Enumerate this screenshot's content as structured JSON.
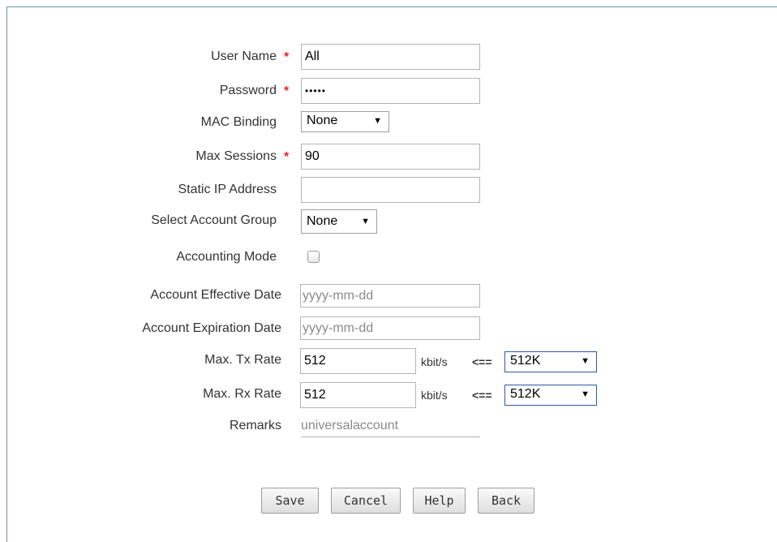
{
  "form": {
    "user_name": {
      "label": "User Name",
      "required": "*",
      "value": "All"
    },
    "password": {
      "label": "Password",
      "required": "*",
      "value": "•••••"
    },
    "mac_binding": {
      "label": "MAC Binding",
      "selected": "None"
    },
    "max_sessions": {
      "label": "Max Sessions",
      "required": "*",
      "value": "90"
    },
    "static_ip": {
      "label": "Static IP Address",
      "value": ""
    },
    "account_group": {
      "label": "Select Account Group",
      "selected": "None"
    },
    "accounting_mode": {
      "label": "Accounting Mode",
      "checked": false
    },
    "effective_date": {
      "label": "Account Effective Date",
      "placeholder": "yyyy-mm-dd"
    },
    "expiration_date": {
      "label": "Account Expiration Date",
      "placeholder": "yyyy-mm-dd"
    },
    "tx_rate": {
      "label": "Max. Tx Rate",
      "value": "512",
      "unit": "kbit/s",
      "arrow": "<==",
      "preset": "512K"
    },
    "rx_rate": {
      "label": "Max. Rx Rate",
      "value": "512",
      "unit": "kbit/s",
      "arrow": "<==",
      "preset": "512K"
    },
    "remarks": {
      "label": "Remarks",
      "value": "universalaccount"
    }
  },
  "icons": {
    "dropdown": "triangle-down-icon"
  },
  "buttons": {
    "save": "Save",
    "cancel": "Cancel",
    "help": "Help",
    "back": "Back"
  },
  "colors": {
    "required": "#e4262a",
    "frame_border": "#5e9c9b",
    "select_focus_border": "#2f58a8"
  }
}
